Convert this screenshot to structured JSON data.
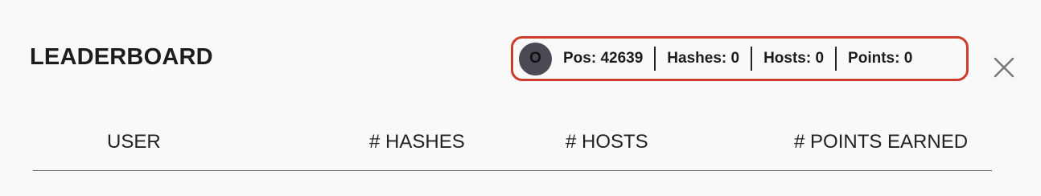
{
  "header": {
    "title": "LEADERBOARD"
  },
  "user_stats": {
    "avatar_initial": "O",
    "position": "Pos: 42639",
    "hashes": "Hashes: 0",
    "hosts": "Hosts: 0",
    "points": "Points: 0"
  },
  "close_icon": "close-icon",
  "table": {
    "columns": [
      "USER",
      "# HASHES",
      "# HOSTS",
      "# POINTS EARNED"
    ]
  },
  "colors": {
    "highlight_border": "#cf3b2b",
    "avatar_bg": "#4a4a55",
    "background": "#f9f9f9"
  }
}
